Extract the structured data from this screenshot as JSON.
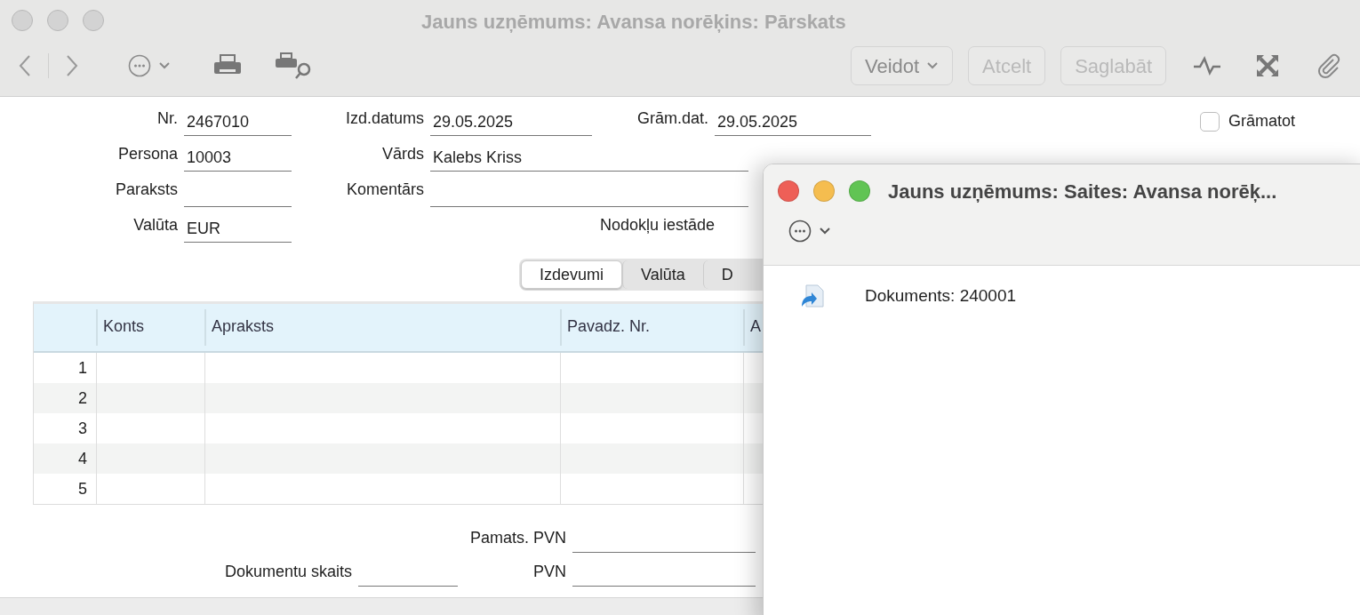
{
  "main_window": {
    "title": "Jauns uzņēmums: Avansa norēķins: Pārskats",
    "active": false,
    "toolbar": {
      "buttons": [
        {
          "label": "Veidot",
          "kind": "menu",
          "disabled": false
        },
        {
          "label": "Atcelt",
          "kind": "plain",
          "disabled": true
        },
        {
          "label": "Saglabāt",
          "kind": "plain",
          "disabled": true
        }
      ]
    },
    "form": {
      "rows": [
        [
          {
            "kind": "field",
            "label": "Nr.",
            "value": "2467010"
          },
          {
            "kind": "field",
            "label": "Izd.datums",
            "value": "29.05.2025"
          },
          {
            "kind": "field",
            "label": "Grām.dat.",
            "value": "29.05.2025"
          }
        ],
        [
          {
            "kind": "field",
            "label": "Persona",
            "value": "10003"
          },
          {
            "kind": "wide",
            "label": "Vārds",
            "value": "Kalebs Kriss"
          }
        ],
        [
          {
            "kind": "field",
            "label": "Paraksts"
          },
          {
            "kind": "wide",
            "label": "Komentārs"
          }
        ],
        [
          {
            "kind": "field",
            "label": "Valūta",
            "value": "EUR"
          },
          "",
          {
            "kind": "label",
            "label": "Nodokļu iestāde"
          }
        ]
      ]
    },
    "post_checkbox": {
      "label": "Grāmatot",
      "checked": false
    },
    "tabs": [
      {
        "label": "Izdevumi",
        "selected": true
      },
      {
        "label": "Valūta",
        "selected": false
      },
      {
        "label": "D",
        "selected": false
      }
    ],
    "table": {
      "columns": [
        "Konts",
        "Apraksts",
        "Pavadz. Nr.",
        "A"
      ],
      "rows": [
        {
          "number": "1"
        },
        {
          "number": "2"
        },
        {
          "number": "3"
        },
        {
          "number": "4"
        },
        {
          "number": "5"
        }
      ]
    },
    "totals": {
      "base_vat_label": "Pamats. PVN",
      "doc_count_label": "Dokumentu skaits",
      "vat_label": "PVN"
    }
  },
  "links_window": {
    "title": "Jauns uzņēmums: Saites: Avansa norēķ...",
    "active": true,
    "items": [
      {
        "label": "Dokuments: 240001"
      }
    ]
  }
}
